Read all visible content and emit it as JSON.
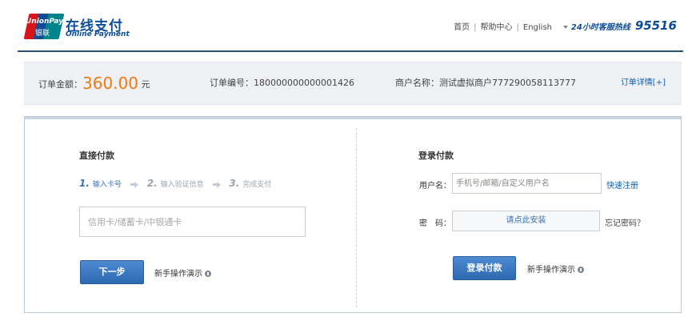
{
  "brand": {
    "logo_top": "UnionPay",
    "logo_bottom": "银联",
    "name_cn": "在线支付",
    "name_en": "Online Payment"
  },
  "topnav": {
    "home": "首页",
    "help": "帮助中心",
    "language": "English",
    "hotline_label": "24小时客服热线",
    "hotline_number": "95516"
  },
  "order": {
    "amount_label": "订单金额：",
    "amount_value": "360.00",
    "amount_unit": "元",
    "id_label": "订单编号：",
    "id_value": "180000000000001426",
    "merchant_label": "商户名称：",
    "merchant_value": "测试虚拟商户777290058113777",
    "detail_link": "订单详情[+]"
  },
  "direct_pay": {
    "title": "直接付款",
    "steps": [
      {
        "num": "1.",
        "label": "输入卡号"
      },
      {
        "num": "2.",
        "label": "输入验证信息"
      },
      {
        "num": "3.",
        "label": "完成支付"
      }
    ],
    "card_placeholder": "信用卡/储蓄卡/中银通卡",
    "next_button": "下一步",
    "demo_link": "新手操作演示"
  },
  "login_pay": {
    "title": "登录付款",
    "username_label": "用户名：",
    "username_placeholder": "手机号/邮箱/自定义用户名",
    "register_link": "快速注册",
    "password_label": "密　码：",
    "password_install": "请点此安装",
    "forgot_link": "忘记密码？",
    "login_button": "登录付款",
    "demo_link": "新手操作演示"
  },
  "colors": {
    "brand_blue": "#0b4f9a",
    "amount_orange": "#f07a12",
    "button_blue": "#2d69b1",
    "link_blue": "#0e5fb5"
  }
}
